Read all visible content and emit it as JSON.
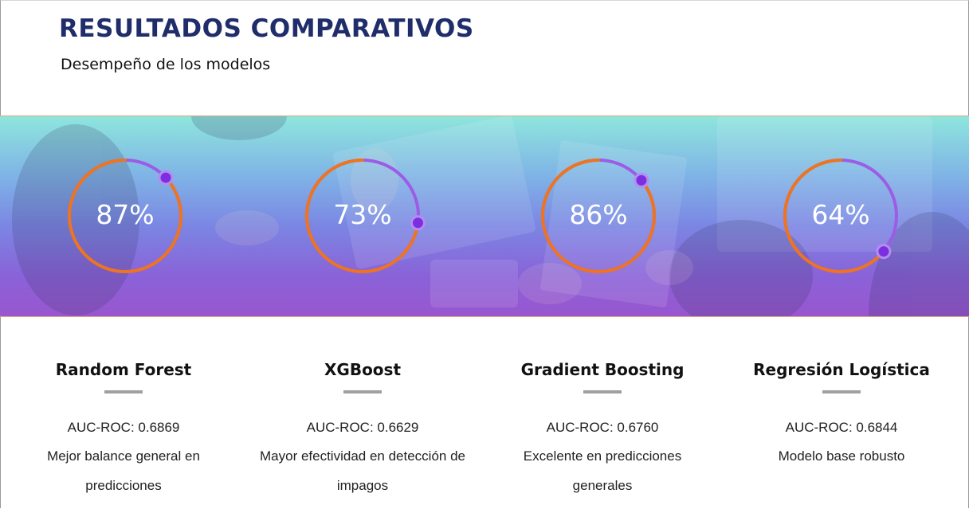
{
  "header": {
    "title": "RESULTADOS COMPARATIVOS",
    "subtitle": "Desempeño de los modelos"
  },
  "colors": {
    "title": "#1f2d6b",
    "ring_orange": "#f0741e",
    "ring_purple": "#9b5de5",
    "dot": "#7b2fe0"
  },
  "gauges": [
    {
      "value": "87%",
      "fraction": 0.87
    },
    {
      "value": "73%",
      "fraction": 0.73
    },
    {
      "value": "86%",
      "fraction": 0.86
    },
    {
      "value": "64%",
      "fraction": 0.64
    }
  ],
  "models": [
    {
      "name": "Random Forest",
      "auc": "AUC-ROC: 0.6869",
      "desc": "Mejor balance general en predicciones"
    },
    {
      "name": "XGBoost",
      "auc": "AUC-ROC: 0.6629",
      "desc": "Mayor efectividad en detección de impagos"
    },
    {
      "name": "Gradient Boosting",
      "auc": "AUC-ROC: 0.6760",
      "desc": "Excelente en predicciones generales"
    },
    {
      "name": "Regresión Logística",
      "auc": "AUC-ROC: 0.6844",
      "desc": "Modelo base robusto"
    }
  ]
}
